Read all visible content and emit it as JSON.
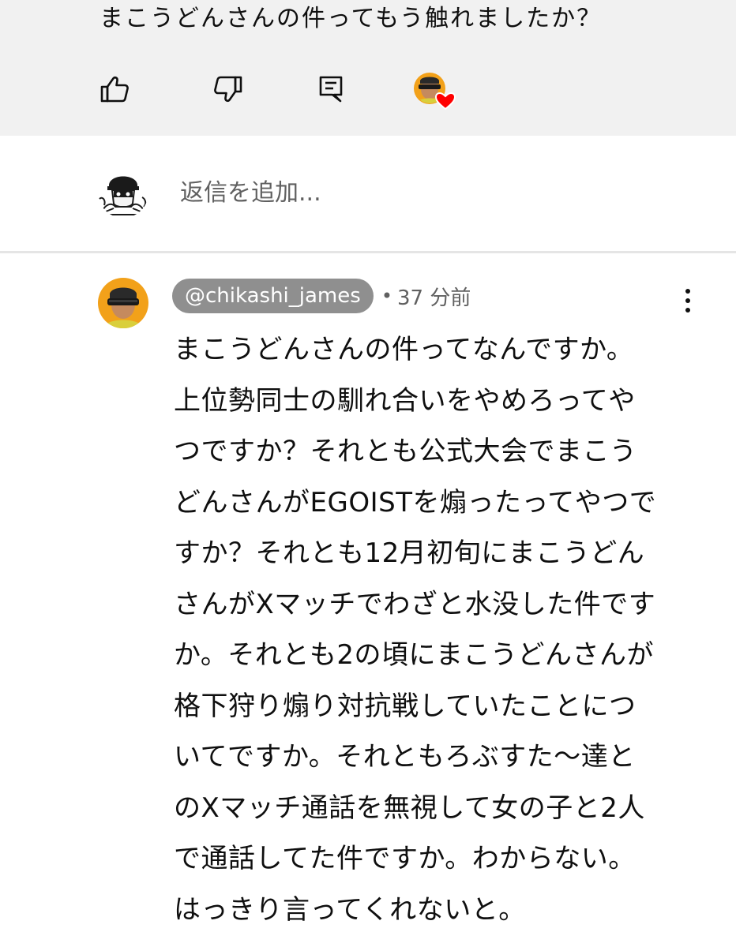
{
  "parent_comment": {
    "text": "まこうどんさんの件ってもう触れましたか？",
    "actions": {
      "like_icon": "thumbs-up-icon",
      "dislike_icon": "thumbs-down-icon",
      "reply_icon": "reply-comment-icon",
      "creator_heart_icon": "creator-heart-icon"
    }
  },
  "reply_box": {
    "placeholder": "返信を追加..."
  },
  "comment": {
    "handle": "@chikashi_james",
    "separator": "•",
    "time": "37 分前",
    "more_icon": "more-vertical-icon",
    "lines": [
      "まこうどんさんの件ってなんですか。",
      "上位勢同士の馴れ合いをやめろってや",
      "つですか？それとも公式大会でまこう",
      "どんさんがEGOISTを煽ったってやつで",
      "すか？それとも12月初旬にまこうどん",
      "さんがXマッチでわざと水没した件です",
      "か。それとも2の頃にまこうどんさんが",
      "格下狩り煽り対抗戦していたことにつ",
      "いてですか。それともろぶすた～達と",
      "のXマッチ通話を無視して女の子と2人",
      "で通話してた件ですか。わからない。",
      "はっきり言ってくれないと。"
    ]
  },
  "colors": {
    "top_background": "#f1f1f1",
    "handle_chip": "#8f8f8f",
    "secondary_text": "#606060",
    "heart": "#ff0000",
    "avatar_ring": "#f2a11a"
  }
}
